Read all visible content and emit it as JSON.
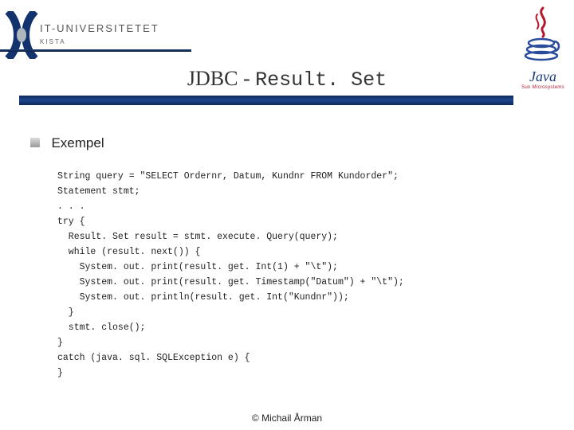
{
  "university": {
    "name": "IT-UNIVERSITETET",
    "sub": "KISTA"
  },
  "java_logo": {
    "word": "Java",
    "sub": "Sun Microsystems"
  },
  "title": {
    "left": "JDBC - ",
    "right": "Result. Set"
  },
  "section": "Exempel",
  "code": "String query = \"SELECT Ordernr, Datum, Kundnr FROM Kundorder\";\nStatement stmt;\n. . .\ntry {\n  Result. Set result = stmt. execute. Query(query);\n  while (result. next()) {\n    System. out. print(result. get. Int(1) + \"\\t\");\n    System. out. print(result. get. Timestamp(\"Datum\") + \"\\t\");\n    System. out. println(result. get. Int(\"Kundnr\"));\n  }\n  stmt. close();\n}\ncatch (java. sql. SQLException e) {\n}",
  "footer": "© Michail Årman"
}
